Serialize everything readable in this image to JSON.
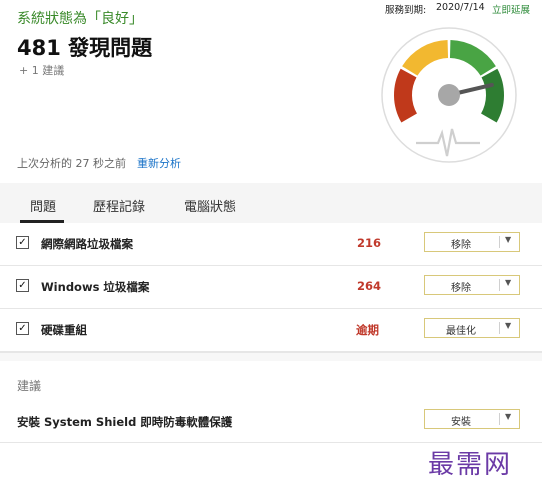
{
  "header": {
    "status": "系統狀態為「良好」",
    "issues": "481 發現問題",
    "suggestions": "+ 1 建議",
    "last_analysis": "上次分析的 27 秒之前",
    "reanalyze": "重新分析",
    "service_label": "服務到期:",
    "service_date": "2020/7/14",
    "extend": "立即延展"
  },
  "gauge": {
    "level": 0.82,
    "colors": [
      "#c0391b",
      "#f2b830",
      "#49a444",
      "#2e7d32"
    ]
  },
  "tabs": [
    {
      "label": "問題",
      "active": true
    },
    {
      "label": "歷程記錄"
    },
    {
      "label": "電腦狀態"
    }
  ],
  "issues": [
    {
      "label": "網際網路垃圾檔案",
      "value": "216",
      "action": "移除",
      "checked": true
    },
    {
      "label": "Windows 垃圾檔案",
      "value": "264",
      "action": "移除",
      "checked": true
    },
    {
      "label": "硬碟重組",
      "value": "逾期",
      "action": "最佳化",
      "checked": true
    }
  ],
  "suggestions_section": {
    "heading": "建議",
    "items": [
      {
        "label": "安裝 System Shield 即時防毒軟體保護",
        "action": "安裝"
      }
    ]
  },
  "watermark": "最需网"
}
